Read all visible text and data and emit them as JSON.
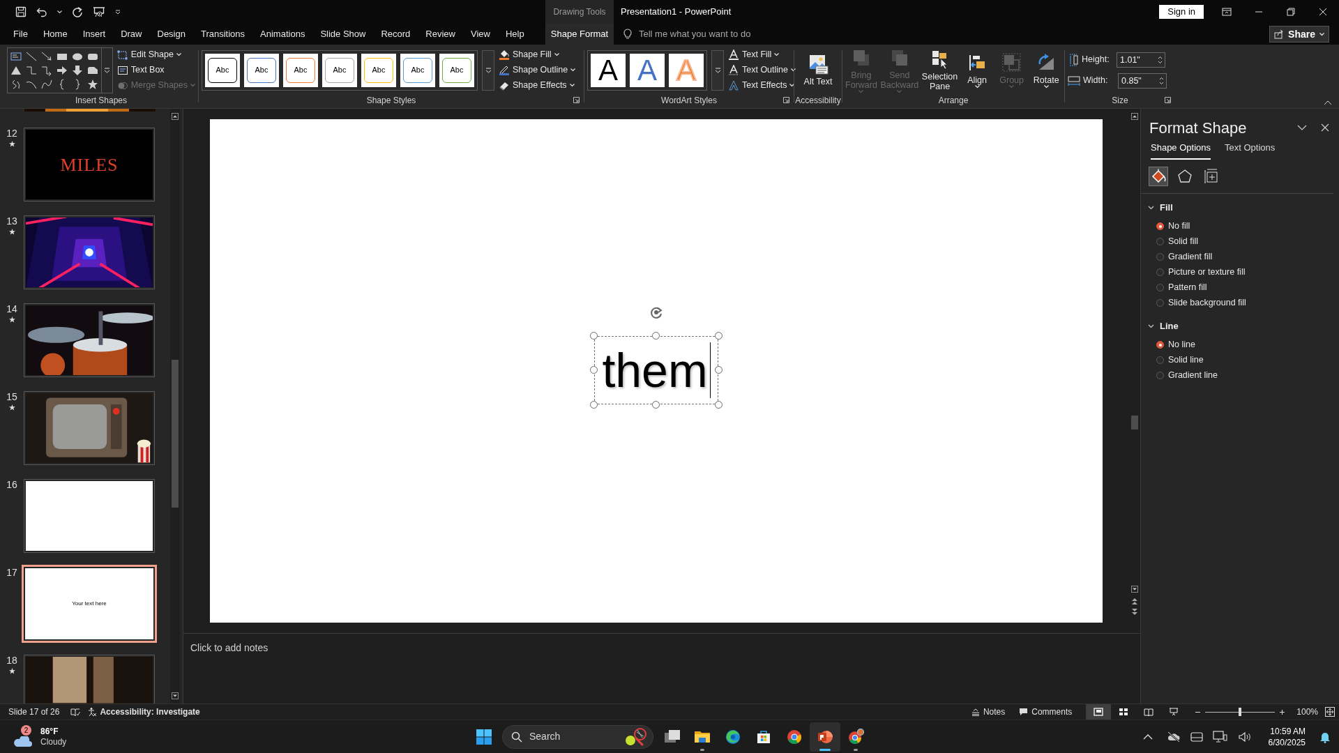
{
  "title_bar": {
    "contextual_tab": "Drawing Tools",
    "title": "Presentation1 - PowerPoint",
    "sign_in": "Sign in"
  },
  "tabs": [
    {
      "label": "File",
      "selected": false,
      "contextual": false
    },
    {
      "label": "Home",
      "selected": false,
      "contextual": false
    },
    {
      "label": "Insert",
      "selected": false,
      "contextual": false
    },
    {
      "label": "Draw",
      "selected": false,
      "contextual": false
    },
    {
      "label": "Design",
      "selected": false,
      "contextual": false
    },
    {
      "label": "Transitions",
      "selected": false,
      "contextual": false
    },
    {
      "label": "Animations",
      "selected": false,
      "contextual": false
    },
    {
      "label": "Slide Show",
      "selected": false,
      "contextual": false
    },
    {
      "label": "Record",
      "selected": false,
      "contextual": false
    },
    {
      "label": "Review",
      "selected": false,
      "contextual": false
    },
    {
      "label": "View",
      "selected": false,
      "contextual": false
    },
    {
      "label": "Help",
      "selected": false,
      "contextual": false
    },
    {
      "label": "Shape Format",
      "selected": true,
      "contextual": true
    }
  ],
  "tell_me": {
    "placeholder": "Tell me what you want to do"
  },
  "share": "Share",
  "ribbon": {
    "insert_shapes": {
      "group_label": "Insert Shapes",
      "commands": [
        {
          "label": "Edit Shape",
          "disabled": false,
          "dropdown": true
        },
        {
          "label": "Text Box",
          "disabled": false,
          "dropdown": false
        },
        {
          "label": "Merge Shapes",
          "disabled": true,
          "dropdown": true
        }
      ]
    },
    "shape_styles": {
      "group_label": "Shape Styles",
      "swatches": [
        {
          "label": "Abc",
          "color": "#000000"
        },
        {
          "label": "Abc",
          "color": "#4472c4"
        },
        {
          "label": "Abc",
          "color": "#ed7d31"
        },
        {
          "label": "Abc",
          "color": "#a5a5a5"
        },
        {
          "label": "Abc",
          "color": "#ffc000"
        },
        {
          "label": "Abc",
          "color": "#5b9bd5"
        },
        {
          "label": "Abc",
          "color": "#70ad47"
        }
      ],
      "commands": [
        {
          "label": "Shape Fill",
          "disabled": false,
          "dropdown": true
        },
        {
          "label": "Shape Outline",
          "disabled": false,
          "dropdown": true
        },
        {
          "label": "Shape Effects",
          "disabled": false,
          "dropdown": true
        }
      ]
    },
    "wordart_styles": {
      "group_label": "WordArt Styles",
      "swatches": [
        {
          "label": "A",
          "kind": "solid",
          "color": "#000000"
        },
        {
          "label": "A",
          "kind": "solid",
          "color": "#4472c4"
        },
        {
          "label": "A",
          "kind": "outline",
          "color": "#ed7d31"
        }
      ],
      "commands": [
        {
          "label": "Text Fill",
          "disabled": false,
          "dropdown": true
        },
        {
          "label": "Text Outline",
          "disabled": false,
          "dropdown": true
        },
        {
          "label": "Text Effects",
          "disabled": false,
          "dropdown": true
        }
      ]
    },
    "accessibility": {
      "group_label": "Accessibility",
      "button": "Alt Text"
    },
    "arrange": {
      "group_label": "Arrange",
      "buttons": [
        {
          "label": "Bring Forward",
          "disabled": true,
          "dropdown": true
        },
        {
          "label": "Send Backward",
          "disabled": true,
          "dropdown": true
        },
        {
          "label": "Selection Pane",
          "disabled": false,
          "dropdown": false
        },
        {
          "label": "Align",
          "disabled": false,
          "dropdown": true
        },
        {
          "label": "Group",
          "disabled": true,
          "dropdown": true
        },
        {
          "label": "Rotate",
          "disabled": false,
          "dropdown": true
        }
      ]
    },
    "size": {
      "group_label": "Size",
      "fields": [
        {
          "label": "Height:",
          "value": "1.01\""
        },
        {
          "label": "Width:",
          "value": "0.85\""
        }
      ]
    }
  },
  "slides": [
    {
      "kind": "picture"
    },
    {
      "number": "12",
      "kind": "title",
      "text": "MILES",
      "animated": true,
      "selected": false
    },
    {
      "number": "13",
      "kind": "picture",
      "animated": true,
      "selected": false
    },
    {
      "number": "14",
      "kind": "picture",
      "animated": true,
      "selected": false
    },
    {
      "number": "15",
      "kind": "picture",
      "animated": true,
      "selected": false
    },
    {
      "number": "16",
      "kind": "blank",
      "animated": false,
      "selected": false
    },
    {
      "number": "17",
      "kind": "text",
      "text": "Your text here",
      "animated": false,
      "selected": true
    },
    {
      "number": "18",
      "kind": "picture",
      "animated": true,
      "selected": false
    }
  ],
  "canvas": {
    "text_box": {
      "text": "them",
      "selected": true
    }
  },
  "notes": {
    "placeholder": "Click to add notes"
  },
  "format_pane": {
    "title": "Format Shape",
    "tabs": [
      {
        "label": "Shape Options",
        "selected": true
      },
      {
        "label": "Text Options",
        "selected": false
      }
    ],
    "icon_tabs": [
      {
        "kind": "fill",
        "selected": true
      },
      {
        "kind": "effects",
        "selected": false
      },
      {
        "kind": "size",
        "selected": false
      }
    ],
    "sections": [
      {
        "heading": "Fill",
        "expanded": true,
        "options": [
          {
            "label": "No fill",
            "selected": true
          },
          {
            "label": "Solid fill",
            "selected": false
          },
          {
            "label": "Gradient fill",
            "selected": false
          },
          {
            "label": "Picture or texture fill",
            "selected": false
          },
          {
            "label": "Pattern fill",
            "selected": false
          },
          {
            "label": "Slide background fill",
            "selected": false
          }
        ]
      },
      {
        "heading": "Line",
        "expanded": true,
        "options": [
          {
            "label": "No line",
            "selected": true
          },
          {
            "label": "Solid line",
            "selected": false
          },
          {
            "label": "Gradient line",
            "selected": false
          }
        ]
      }
    ]
  },
  "status_bar": {
    "slide_info": "Slide 17 of 26",
    "accessibility": "Accessibility: Investigate",
    "notes": "Notes",
    "comments": "Comments",
    "views": [
      {
        "kind": "normal",
        "selected": true
      },
      {
        "kind": "sorter",
        "selected": false
      },
      {
        "kind": "reading",
        "selected": false
      },
      {
        "kind": "slideshow",
        "selected": false
      }
    ],
    "zoom": {
      "level": 0.5,
      "reading": "100%"
    }
  },
  "taskbar": {
    "weather": {
      "temperature": "86°F",
      "condition": "Cloudy",
      "badge": "2"
    },
    "search": {
      "placeholder": "Search"
    },
    "apps": [
      {
        "kind": "task-view",
        "running": false,
        "selected": false
      },
      {
        "kind": "folder",
        "running": true,
        "selected": false
      },
      {
        "kind": "edge",
        "running": false,
        "selected": false
      },
      {
        "kind": "store",
        "running": false,
        "selected": false
      },
      {
        "kind": "chrome",
        "running": false,
        "selected": false
      },
      {
        "kind": "powerpoint",
        "running": true,
        "selected": true
      },
      {
        "kind": "chrome-profile",
        "running": true,
        "selected": false
      }
    ],
    "clock": {
      "time": "10:59 AM",
      "date": "6/30/2025"
    }
  }
}
